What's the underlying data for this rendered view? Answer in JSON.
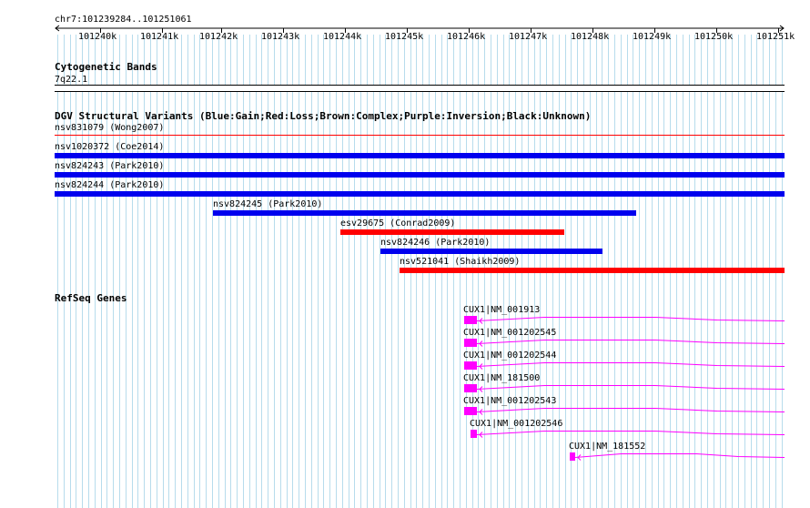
{
  "ruler": {
    "region": "chr7:101239284..101251061",
    "ticks": [
      "101240k",
      "101241k",
      "101242k",
      "101243k",
      "101244k",
      "101245k",
      "101246k",
      "101247k",
      "101248k",
      "101249k",
      "101250k",
      "101251k"
    ]
  },
  "cytobands": {
    "title": "Cytogenetic Bands",
    "band": "7q22.1"
  },
  "dgv": {
    "title": "DGV Structural Variants (Blue:Gain;Red:Loss;Brown:Complex;Purple:Inversion;Black:Unknown)",
    "legend_colors": {
      "gain": "#0000ee",
      "loss": "#ff0000"
    },
    "variants": [
      {
        "label": "nsv831079 (Wong2007)",
        "type": "loss"
      },
      {
        "label": "nsv1020372 (Coe2014)",
        "type": "gain"
      },
      {
        "label": "nsv824243 (Park2010)",
        "type": "gain"
      },
      {
        "label": "nsv824244 (Park2010)",
        "type": "gain"
      },
      {
        "label": "nsv824245 (Park2010)",
        "type": "gain"
      },
      {
        "label": "esv29675 (Conrad2009)",
        "type": "loss"
      },
      {
        "label": "nsv824246 (Park2010)",
        "type": "gain"
      },
      {
        "label": "nsv521041 (Shaikh2009)",
        "type": "loss"
      }
    ]
  },
  "refseq": {
    "title": "RefSeq Genes",
    "color": "#ff00ff",
    "genes": [
      {
        "label": "CUX1|NM_001913"
      },
      {
        "label": "CUX1|NM_001202545"
      },
      {
        "label": "CUX1|NM_001202544"
      },
      {
        "label": "CUX1|NM_181500"
      },
      {
        "label": "CUX1|NM_001202543"
      },
      {
        "label": "CUX1|NM_001202546"
      },
      {
        "label": "CUX1|NM_181552"
      }
    ]
  }
}
